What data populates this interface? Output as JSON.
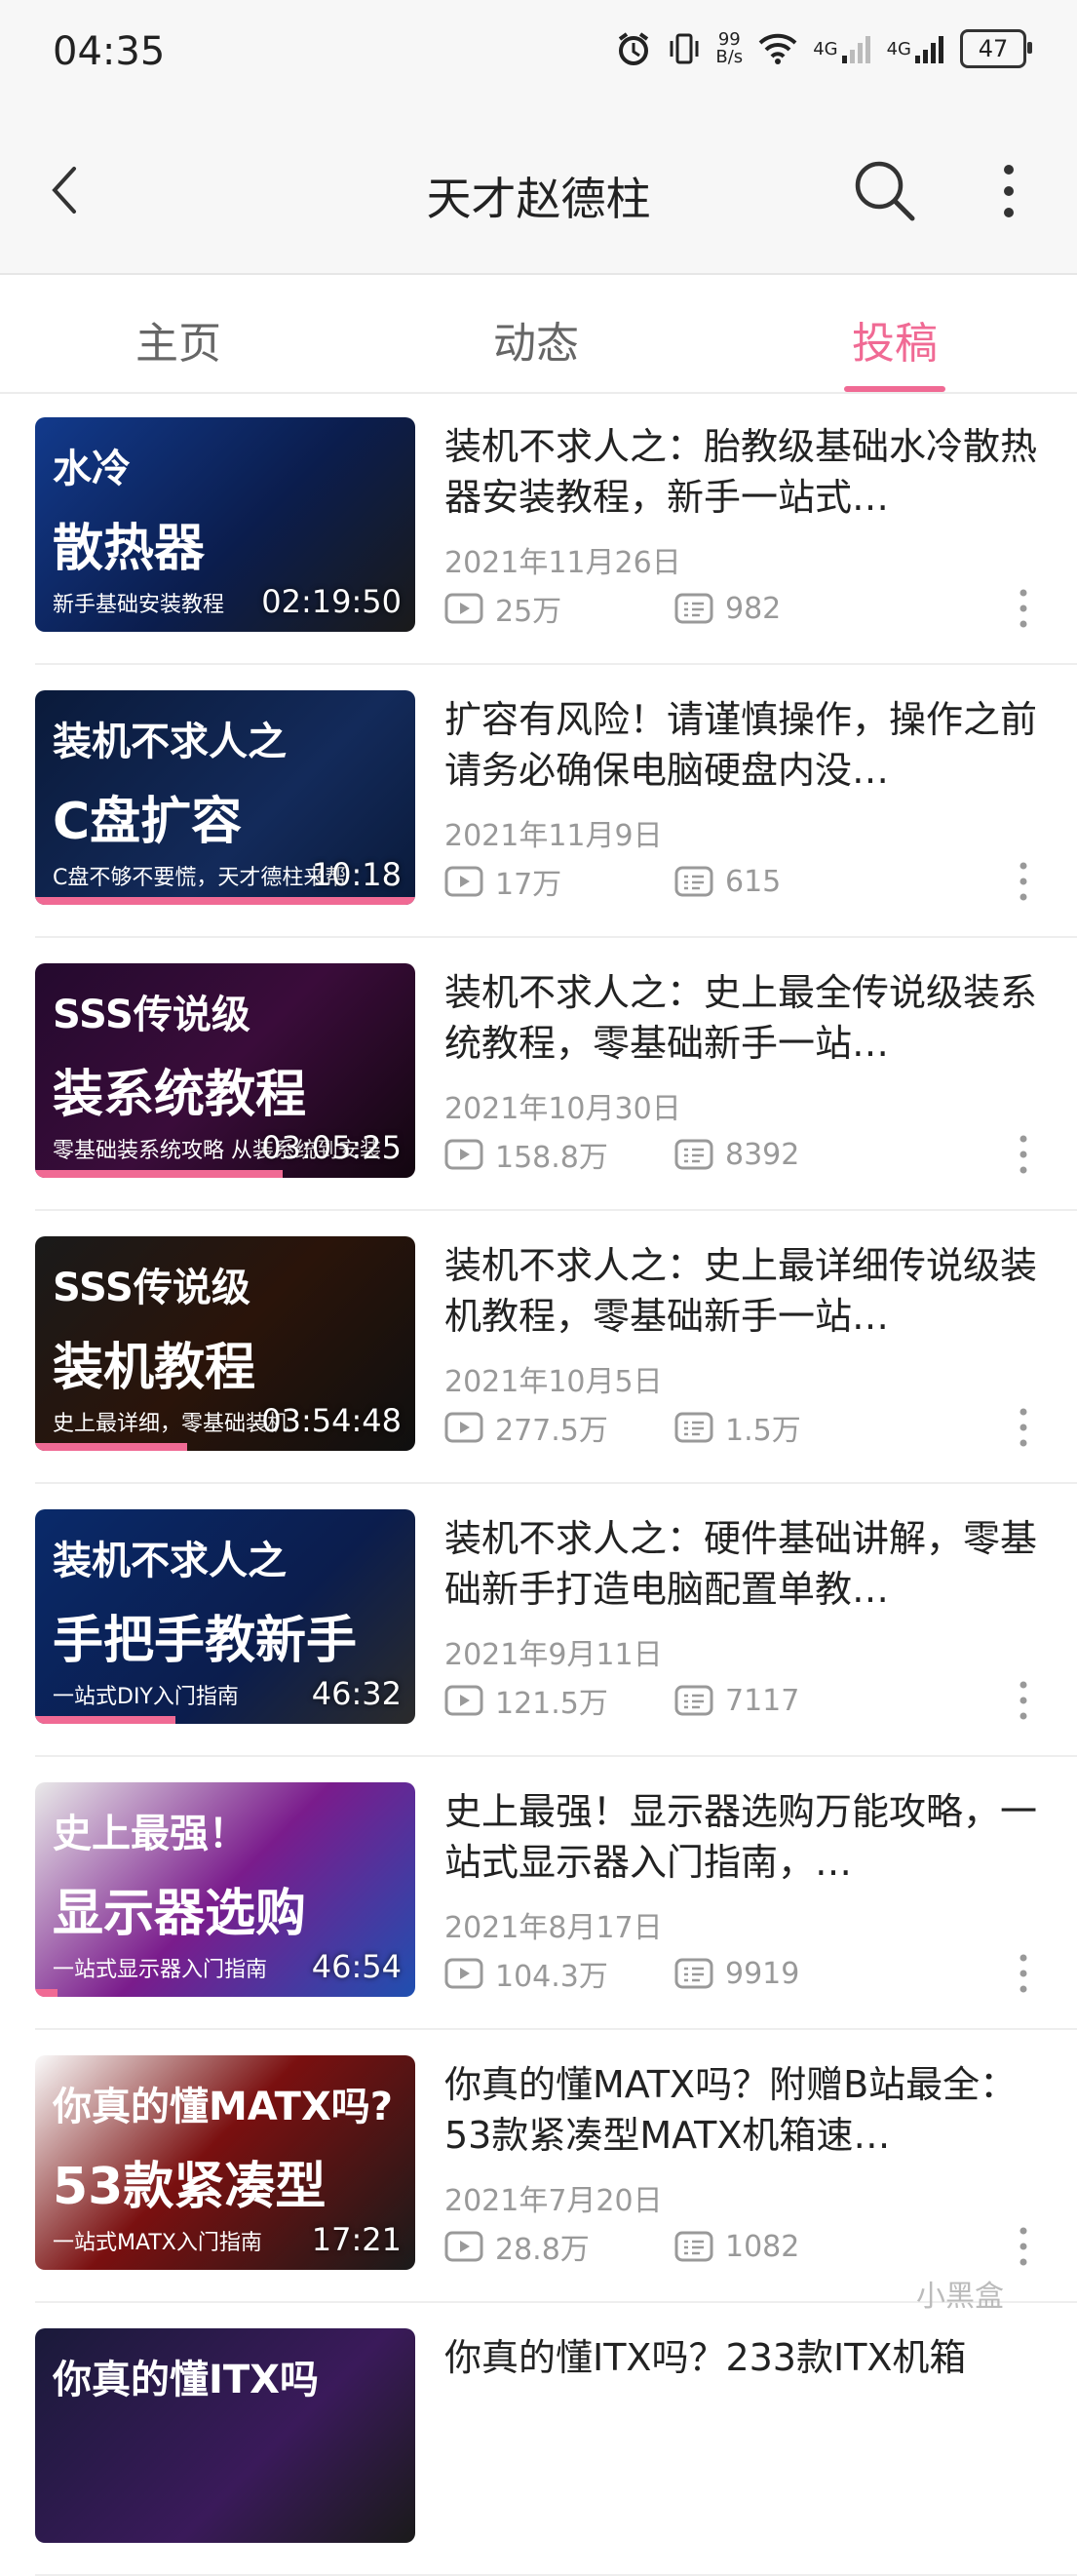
{
  "status_bar": {
    "time": "04:35",
    "net_speed_top": "99",
    "net_speed_bottom": "B/s",
    "signal1_label": "4G",
    "signal2_label": "4G",
    "battery": "47"
  },
  "header": {
    "title": "天才赵德柱"
  },
  "tabs": [
    {
      "label": "主页"
    },
    {
      "label": "动态"
    },
    {
      "label": "投稿"
    }
  ],
  "active_tab": "投稿",
  "accent_color": "#f06a94",
  "videos": [
    {
      "thumb_line1": "水冷",
      "thumb_line2": "散热器",
      "thumb_sub": "新手基础安装教程",
      "duration": "02:19:50",
      "title": "装机不求人之：胎教级基础水冷散热器安装教程，新手一站式…",
      "date": "2021年11月26日",
      "views": "25万",
      "comments": "982",
      "watched_fraction": 0
    },
    {
      "thumb_line1": "装机不求人之",
      "thumb_line2": "C盘扩容",
      "thumb_sub": "C盘不够不要慌，天才德柱来帮",
      "duration": "10:18",
      "title": "扩容有风险！请谨慎操作，操作之前请务必确保电脑硬盘内没…",
      "date": "2021年11月9日",
      "views": "17万",
      "comments": "615",
      "watched_fraction": 1
    },
    {
      "thumb_line1": "SSS传说级",
      "thumb_line2": "装系统教程",
      "thumb_sub": "零基础装系统攻略 从装系统到安装",
      "duration": "03:05:25",
      "title": "装机不求人之：史上最全传说级装系统教程，零基础新手一站…",
      "date": "2021年10月30日",
      "views": "158.8万",
      "comments": "8392",
      "watched_fraction": 0.65
    },
    {
      "thumb_line1": "SSS传说级",
      "thumb_line2": "装机教程",
      "thumb_sub": "史上最详细，零基础装机",
      "duration": "03:54:48",
      "title": "装机不求人之：史上最详细传说级装机教程，零基础新手一站…",
      "date": "2021年10月5日",
      "views": "277.5万",
      "comments": "1.5万",
      "watched_fraction": 0.4
    },
    {
      "thumb_line1": "装机不求人之",
      "thumb_line2": "手把手教新手",
      "thumb_sub": "一站式DIY入门指南",
      "duration": "46:32",
      "title": "装机不求人之：硬件基础讲解，零基础新手打造电脑配置单教…",
      "date": "2021年9月11日",
      "views": "121.5万",
      "comments": "7117",
      "watched_fraction": 0.37
    },
    {
      "thumb_line1": "史上最强！",
      "thumb_line2": "显示器选购",
      "thumb_sub": "一站式显示器入门指南",
      "duration": "46:54",
      "title": "史上最强！显示器选购万能攻略，一站式显示器入门指南，…",
      "date": "2021年8月17日",
      "views": "104.3万",
      "comments": "9919",
      "watched_fraction": 0.06
    },
    {
      "thumb_line1": "你真的懂MATX吗?",
      "thumb_line2": "53款紧凑型",
      "thumb_sub": "一站式MATX入门指南",
      "duration": "17:21",
      "title": "你真的懂MATX吗？附赠B站最全：53款紧凑型MATX机箱速…",
      "date": "2021年7月20日",
      "views": "28.8万",
      "comments": "1082",
      "watched_fraction": 0
    },
    {
      "thumb_line1": "你真的懂ITX吗",
      "thumb_line2": "",
      "thumb_sub": "",
      "duration": "",
      "title": "你真的懂ITX吗？233款ITX机箱",
      "date": "",
      "views": "",
      "comments": "",
      "watched_fraction": 0
    }
  ],
  "watermark": "小黑盒"
}
